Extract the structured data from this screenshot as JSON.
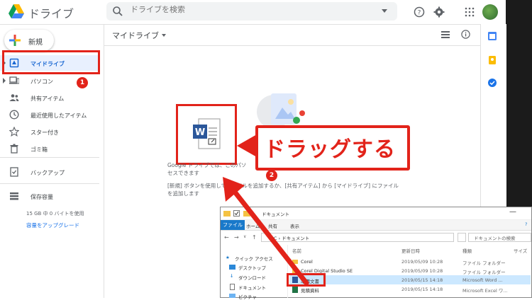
{
  "header": {
    "app_title": "ドライブ",
    "search_placeholder": "ドライブを検索"
  },
  "sidebar": {
    "new_label": "新規",
    "items": [
      {
        "label": "マイドライブ",
        "icon": "drive-icon",
        "active": true
      },
      {
        "label": "パソコン",
        "icon": "computer-icon"
      },
      {
        "label": "共有アイテム",
        "icon": "people-icon"
      },
      {
        "label": "最近使用したアイテム",
        "icon": "clock-icon"
      },
      {
        "label": "スター付き",
        "icon": "star-icon"
      },
      {
        "label": "ゴミ箱",
        "icon": "trash-icon"
      },
      {
        "label": "バックアップ",
        "icon": "backup-icon"
      }
    ],
    "storage_label": "保存容量",
    "storage_usage": "15 GB 中 0 バイトを使用",
    "upgrade_link": "容量をアップグレード"
  },
  "main": {
    "title": "マイドライブ",
    "empty_line1": "Google ドライブでは、このパソ",
    "empty_line2": "セスできます",
    "empty_line3": "[新規] ボタンを使用してファイルを追加するか、[共有アイテム] から [マイドライブ] にファイル",
    "empty_line4": "を追加します"
  },
  "annotations": {
    "callout": "ドラッグする",
    "badge1": "1",
    "badge2": "2",
    "accent": "#e2231a"
  },
  "explorer": {
    "title": "ドキュメント",
    "ribbon_tabs": [
      "ファイル",
      "ホーム",
      "共有",
      "表示"
    ],
    "path": "PC › ドキュメント",
    "search_placeholder": "ドキュメントの検索",
    "columns": [
      "名前",
      "更新日時",
      "種類",
      "サイズ"
    ],
    "nav": [
      "クイック アクセス",
      "デスクトップ",
      "ダウンロード",
      "ドキュメント",
      "ピクチャ"
    ],
    "rows": [
      {
        "name": "Corel",
        "date": "2019/05/09 10:28",
        "type": "ファイル フォルダー"
      },
      {
        "name": "Corel Digital Studio SE",
        "date": "2019/05/09 10:28",
        "type": "ファイル フォルダー"
      },
      {
        "name": "準備文書",
        "date": "2019/05/15 14:18",
        "type": "Microsoft Word ..."
      },
      {
        "name": "見積資料",
        "date": "2019/05/15 14:18",
        "type": "Microsoft Excel ワ..."
      }
    ]
  }
}
